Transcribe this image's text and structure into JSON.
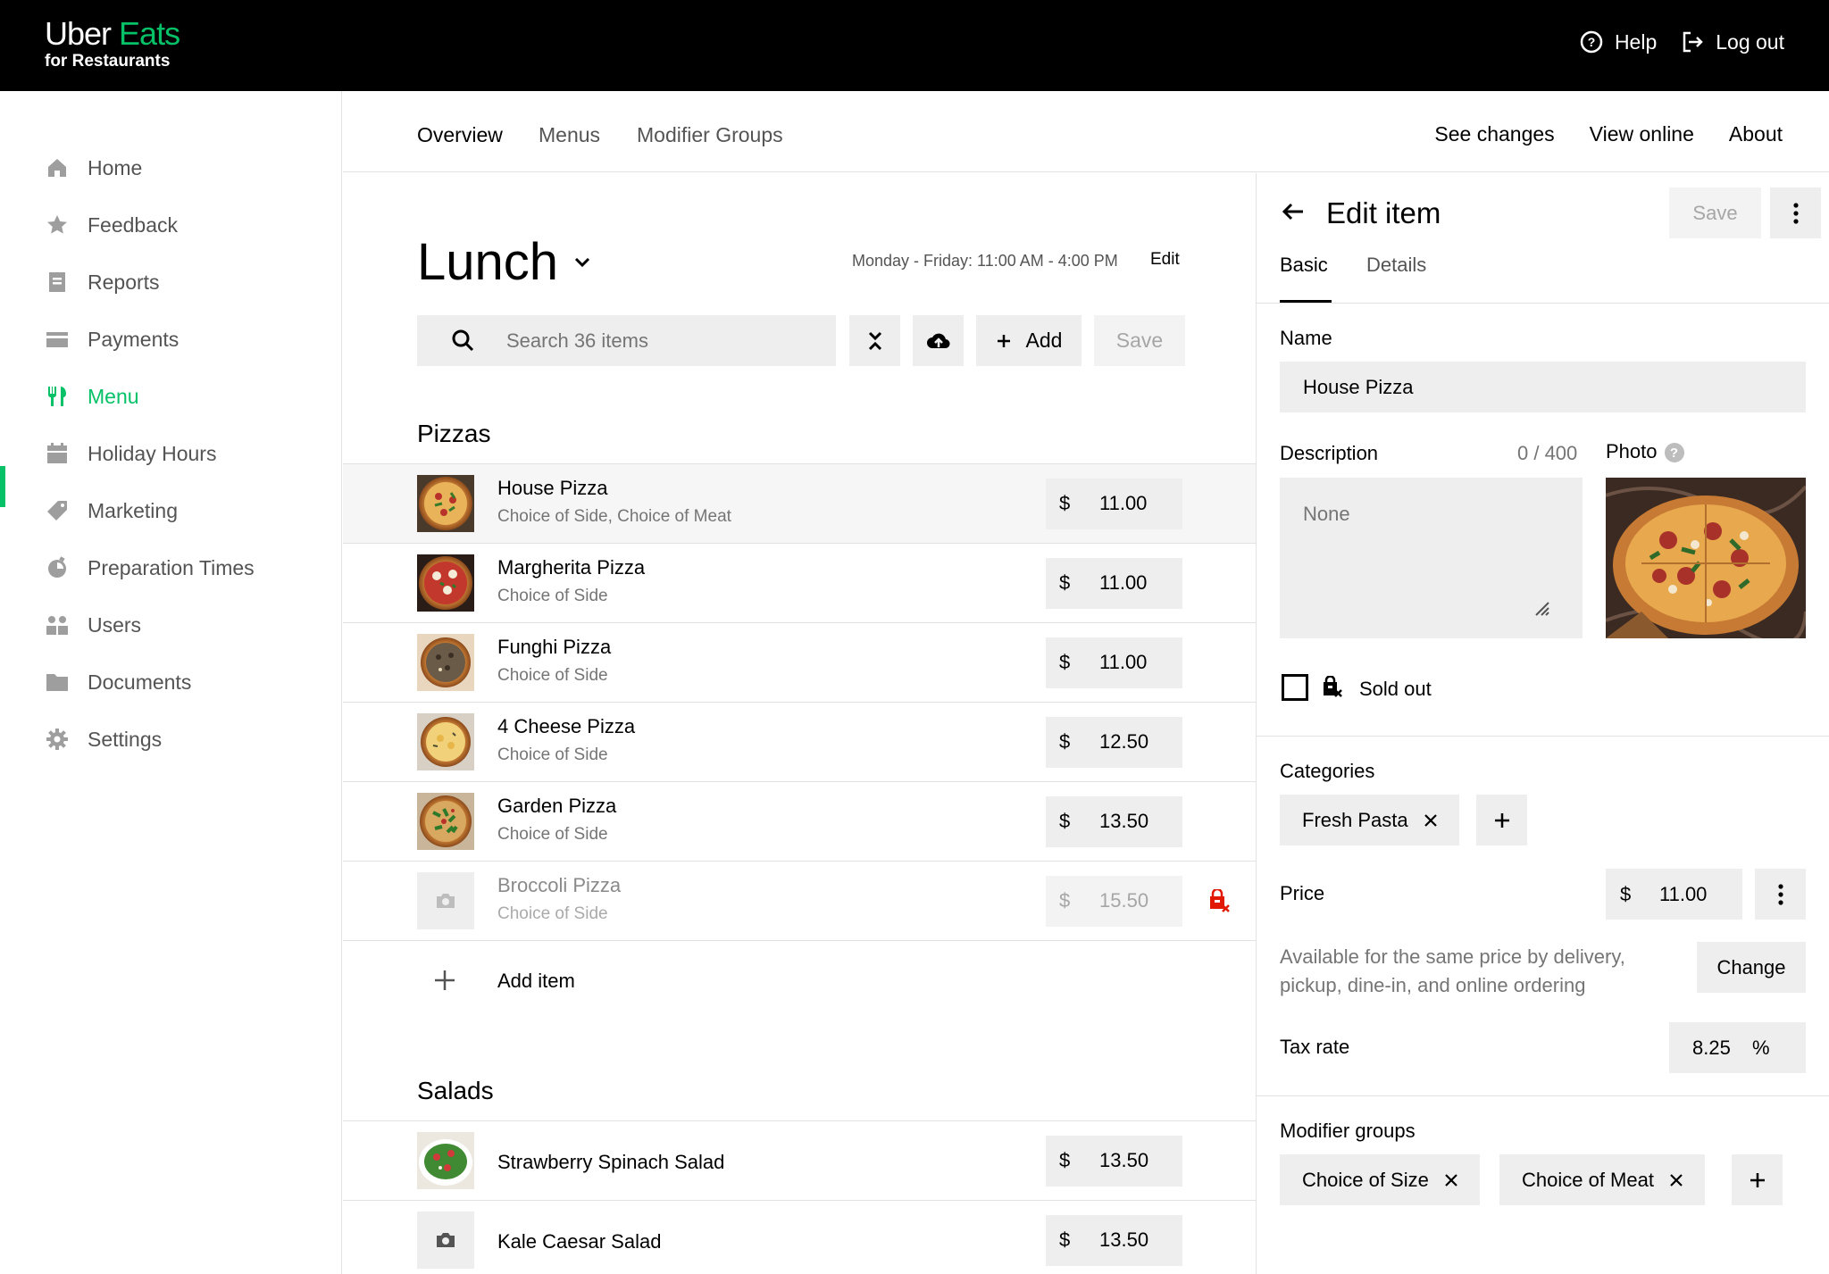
{
  "brand": {
    "line1_a": "Uber",
    "line1_b": "Eats",
    "line2": "for Restaurants"
  },
  "topbar": {
    "help": "Help",
    "logout": "Log out"
  },
  "sidebar": {
    "items": [
      {
        "label": "Home",
        "icon": "home-icon"
      },
      {
        "label": "Feedback",
        "icon": "star-icon"
      },
      {
        "label": "Reports",
        "icon": "report-icon"
      },
      {
        "label": "Payments",
        "icon": "card-icon"
      },
      {
        "label": "Menu",
        "icon": "utensils-icon",
        "active": true
      },
      {
        "label": "Holiday Hours",
        "icon": "calendar-icon"
      },
      {
        "label": "Marketing",
        "icon": "tag-icon"
      },
      {
        "label": "Preparation Times",
        "icon": "timer-icon"
      },
      {
        "label": "Users",
        "icon": "users-icon"
      },
      {
        "label": "Documents",
        "icon": "folder-icon"
      },
      {
        "label": "Settings",
        "icon": "gear-icon"
      }
    ]
  },
  "tabs": {
    "overview": "Overview",
    "menus": "Menus",
    "modifier_groups": "Modifier Groups"
  },
  "links": {
    "see_changes": "See changes",
    "view_online": "View online",
    "about": "About"
  },
  "menu": {
    "title": "Lunch",
    "hours": "Monday - Friday: 11:00 AM - 4:00 PM",
    "edit": "Edit",
    "search_placeholder": "Search 36 items",
    "add": "Add",
    "save": "Save"
  },
  "sections": {
    "pizzas": {
      "title": "Pizzas",
      "items": [
        {
          "name": "House Pizza",
          "sub": "Choice of Side, Choice of Meat",
          "currency": "$",
          "price": "11.00"
        },
        {
          "name": "Margherita Pizza",
          "sub": "Choice of Side",
          "currency": "$",
          "price": "11.00"
        },
        {
          "name": "Funghi Pizza",
          "sub": "Choice of Side",
          "currency": "$",
          "price": "11.00"
        },
        {
          "name": "4 Cheese Pizza",
          "sub": "Choice of Side",
          "currency": "$",
          "price": "12.50"
        },
        {
          "name": "Garden Pizza",
          "sub": "Choice of Side",
          "currency": "$",
          "price": "13.50"
        },
        {
          "name": "Broccoli Pizza",
          "sub": "Choice of Side",
          "currency": "$",
          "price": "15.50",
          "sold_out": true
        }
      ],
      "add_item": "Add item"
    },
    "salads": {
      "title": "Salads",
      "items": [
        {
          "name": "Strawberry Spinach Salad",
          "currency": "$",
          "price": "13.50"
        },
        {
          "name": "Kale Caesar Salad",
          "currency": "$",
          "price": "13.50"
        }
      ]
    }
  },
  "edit_panel": {
    "title": "Edit item",
    "save": "Save",
    "tabs": {
      "basic": "Basic",
      "details": "Details"
    },
    "name_label": "Name",
    "name_value": "House Pizza",
    "description_label": "Description",
    "description_counter": "0 / 400",
    "description_placeholder": "None",
    "photo_label": "Photo",
    "sold_out_label": "Sold out",
    "categories_label": "Categories",
    "categories": [
      "Fresh Pasta"
    ],
    "price_label": "Price",
    "price_currency": "$",
    "price_value": "11.00",
    "availability_text": "Available for the same price by delivery, pickup, dine-in, and online ordering",
    "change": "Change",
    "tax_label": "Tax rate",
    "tax_value": "8.25",
    "tax_unit": "%",
    "modifier_label": "Modifier groups",
    "modifiers": [
      "Choice of Size",
      "Choice of Meat"
    ]
  },
  "colors": {
    "accent": "#06c167",
    "sold_out_red": "#e11900",
    "field_bg": "#eeeeee"
  }
}
